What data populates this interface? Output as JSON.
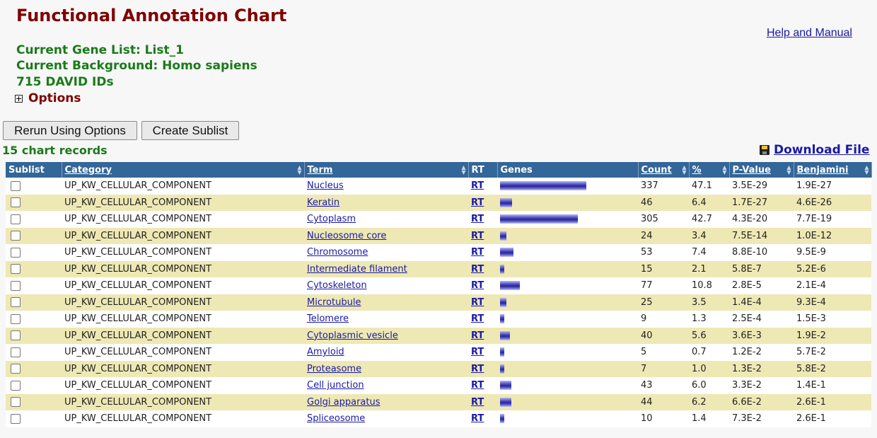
{
  "page": {
    "title": "Functional Annotation Chart",
    "help_link": "Help and Manual",
    "gene_list": "Current Gene List: List_1",
    "background": "Current Background: Homo sapiens",
    "id_count": "715 DAVID IDs",
    "options_label": "Options"
  },
  "buttons": {
    "rerun": "Rerun Using Options",
    "create_sublist": "Create Sublist"
  },
  "records_label": "15 chart records",
  "download_label": "Download File",
  "table": {
    "headers": [
      "Sublist",
      "Category",
      "Term",
      "RT",
      "Genes",
      "Count",
      "%",
      "P-Value",
      "Benjamini"
    ],
    "rows": [
      {
        "category": "UP_KW_CELLULAR_COMPONENT",
        "term": "Nucleus",
        "rt": "RT",
        "count": "337",
        "percent": "47.1",
        "pvalue": "3.5E-29",
        "benjamini": "1.9E-27"
      },
      {
        "category": "UP_KW_CELLULAR_COMPONENT",
        "term": "Keratin",
        "rt": "RT",
        "count": "46",
        "percent": "6.4",
        "pvalue": "1.7E-27",
        "benjamini": "4.6E-26"
      },
      {
        "category": "UP_KW_CELLULAR_COMPONENT",
        "term": "Cytoplasm",
        "rt": "RT",
        "count": "305",
        "percent": "42.7",
        "pvalue": "4.3E-20",
        "benjamini": "7.7E-19"
      },
      {
        "category": "UP_KW_CELLULAR_COMPONENT",
        "term": "Nucleosome core",
        "rt": "RT",
        "count": "24",
        "percent": "3.4",
        "pvalue": "7.5E-14",
        "benjamini": "1.0E-12"
      },
      {
        "category": "UP_KW_CELLULAR_COMPONENT",
        "term": "Chromosome",
        "rt": "RT",
        "count": "53",
        "percent": "7.4",
        "pvalue": "8.8E-10",
        "benjamini": "9.5E-9"
      },
      {
        "category": "UP_KW_CELLULAR_COMPONENT",
        "term": "Intermediate filament",
        "rt": "RT",
        "count": "15",
        "percent": "2.1",
        "pvalue": "5.8E-7",
        "benjamini": "5.2E-6"
      },
      {
        "category": "UP_KW_CELLULAR_COMPONENT",
        "term": "Cytoskeleton",
        "rt": "RT",
        "count": "77",
        "percent": "10.8",
        "pvalue": "2.8E-5",
        "benjamini": "2.1E-4"
      },
      {
        "category": "UP_KW_CELLULAR_COMPONENT",
        "term": "Microtubule",
        "rt": "RT",
        "count": "25",
        "percent": "3.5",
        "pvalue": "1.4E-4",
        "benjamini": "9.3E-4"
      },
      {
        "category": "UP_KW_CELLULAR_COMPONENT",
        "term": "Telomere",
        "rt": "RT",
        "count": "9",
        "percent": "1.3",
        "pvalue": "2.5E-4",
        "benjamini": "1.5E-3"
      },
      {
        "category": "UP_KW_CELLULAR_COMPONENT",
        "term": "Cytoplasmic vesicle",
        "rt": "RT",
        "count": "40",
        "percent": "5.6",
        "pvalue": "3.6E-3",
        "benjamini": "1.9E-2"
      },
      {
        "category": "UP_KW_CELLULAR_COMPONENT",
        "term": "Amyloid",
        "rt": "RT",
        "count": "5",
        "percent": "0.7",
        "pvalue": "1.2E-2",
        "benjamini": "5.7E-2"
      },
      {
        "category": "UP_KW_CELLULAR_COMPONENT",
        "term": "Proteasome",
        "rt": "RT",
        "count": "7",
        "percent": "1.0",
        "pvalue": "1.3E-2",
        "benjamini": "5.8E-2"
      },
      {
        "category": "UP_KW_CELLULAR_COMPONENT",
        "term": "Cell junction",
        "rt": "RT",
        "count": "43",
        "percent": "6.0",
        "pvalue": "3.3E-2",
        "benjamini": "1.4E-1"
      },
      {
        "category": "UP_KW_CELLULAR_COMPONENT",
        "term": "Golgi apparatus",
        "rt": "RT",
        "count": "44",
        "percent": "6.2",
        "pvalue": "6.6E-2",
        "benjamini": "2.6E-1"
      },
      {
        "category": "UP_KW_CELLULAR_COMPONENT",
        "term": "Spliceosome",
        "rt": "RT",
        "count": "10",
        "percent": "1.4",
        "pvalue": "7.3E-2",
        "benjamini": "2.6E-1"
      }
    ]
  },
  "colors": {
    "title": "#800000",
    "info_green": "#1a7a1a",
    "header_bg": "#336699",
    "row_alt": "#eee8b4",
    "link": "#1a1aa6"
  },
  "icons": [
    "plus-box-icon",
    "floppy-disk-icon",
    "sort-arrows-icon",
    "checkbox-icon"
  ]
}
